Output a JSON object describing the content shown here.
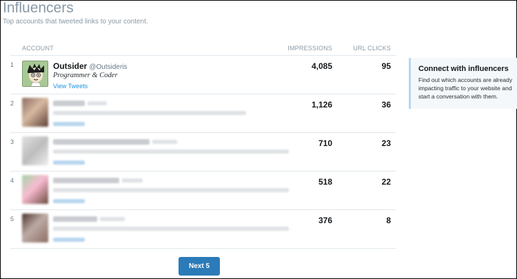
{
  "page": {
    "title": "Influencers",
    "subtitle": "Top accounts that tweeted links to your content."
  },
  "table": {
    "headers": {
      "account": "ACCOUNT",
      "impressions": "IMPRESSIONS",
      "url_clicks": "URL CLICKS"
    },
    "rows": [
      {
        "rank": "1",
        "name": "Outsider",
        "handle": "@Outsideris",
        "bio": "Programmer & Coder",
        "view_label": "View Tweets",
        "impressions": "4,085",
        "url_clicks": "95",
        "blurred": false
      },
      {
        "rank": "2",
        "impressions": "1,126",
        "url_clicks": "36",
        "blurred": true
      },
      {
        "rank": "3",
        "impressions": "710",
        "url_clicks": "23",
        "blurred": true
      },
      {
        "rank": "4",
        "impressions": "518",
        "url_clicks": "22",
        "blurred": true
      },
      {
        "rank": "5",
        "impressions": "376",
        "url_clicks": "8",
        "blurred": true
      }
    ]
  },
  "panel": {
    "title": "Connect with influencers",
    "text": "Find out which accounts are already impacting traffic to your website and start a conversation with them."
  },
  "pagination": {
    "next_label": "Next 5"
  },
  "colors": {
    "link": "#1b95e0",
    "button": "#2b7bb9",
    "muted": "#8899a6"
  }
}
